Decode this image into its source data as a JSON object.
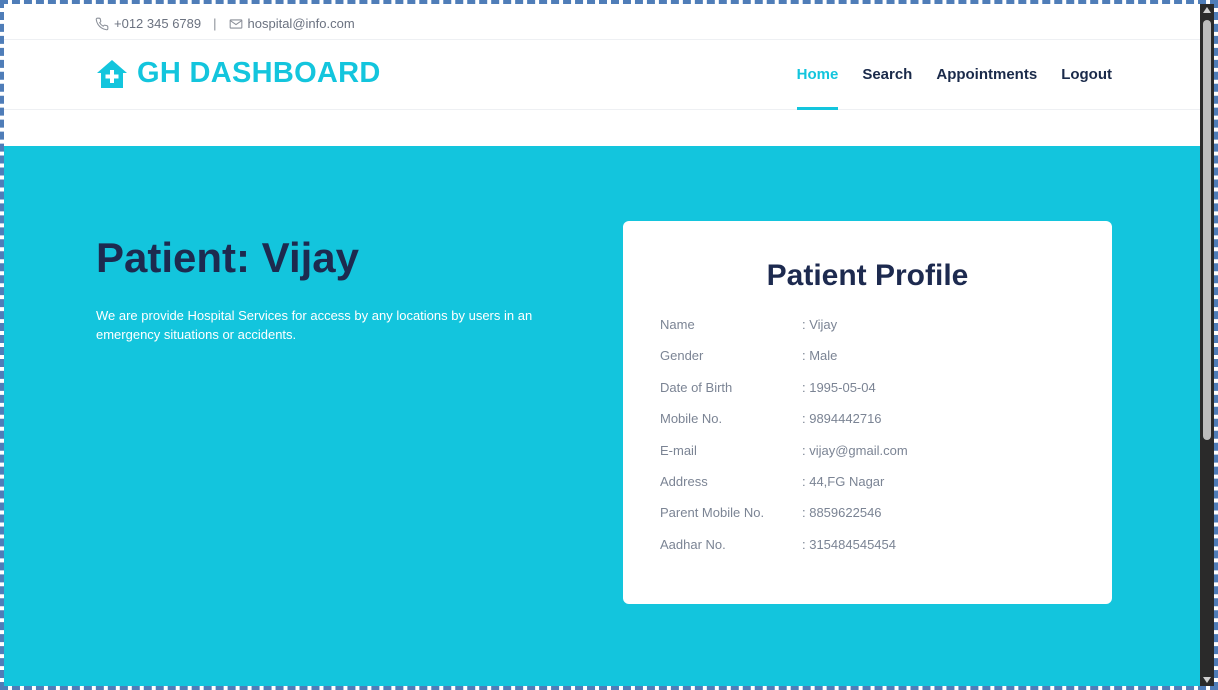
{
  "topbar": {
    "phone": "+012 345 6789",
    "separator": "|",
    "email": "hospital@info.com"
  },
  "brand": {
    "name": "GH DASHBOARD",
    "color": "#13c5dd"
  },
  "nav": {
    "home": "Home",
    "search": "Search",
    "appointments": "Appointments",
    "logout": "Logout",
    "active": "Home"
  },
  "hero": {
    "title": "Patient: Vijay",
    "description": "We are provide Hospital Services for access by any locations by users in an emergency situations or accidents.",
    "background": "#13c5dd"
  },
  "profile": {
    "title": "Patient Profile",
    "fields": [
      {
        "label": "Name",
        "value": ": Vijay"
      },
      {
        "label": "Gender",
        "value": ": Male"
      },
      {
        "label": "Date of Birth",
        "value": ": 1995-05-04"
      },
      {
        "label": "Mobile No.",
        "value": ": 9894442716"
      },
      {
        "label": "E-mail",
        "value": ": vijay@gmail.com"
      },
      {
        "label": "Address",
        "value": ": 44,FG Nagar"
      },
      {
        "label": "Parent Mobile No.",
        "value": ": 8859622546"
      },
      {
        "label": "Aadhar No.",
        "value": ": 315484545454"
      }
    ]
  },
  "icons": [
    "phone-icon",
    "mail-icon",
    "hospital-house-icon"
  ]
}
